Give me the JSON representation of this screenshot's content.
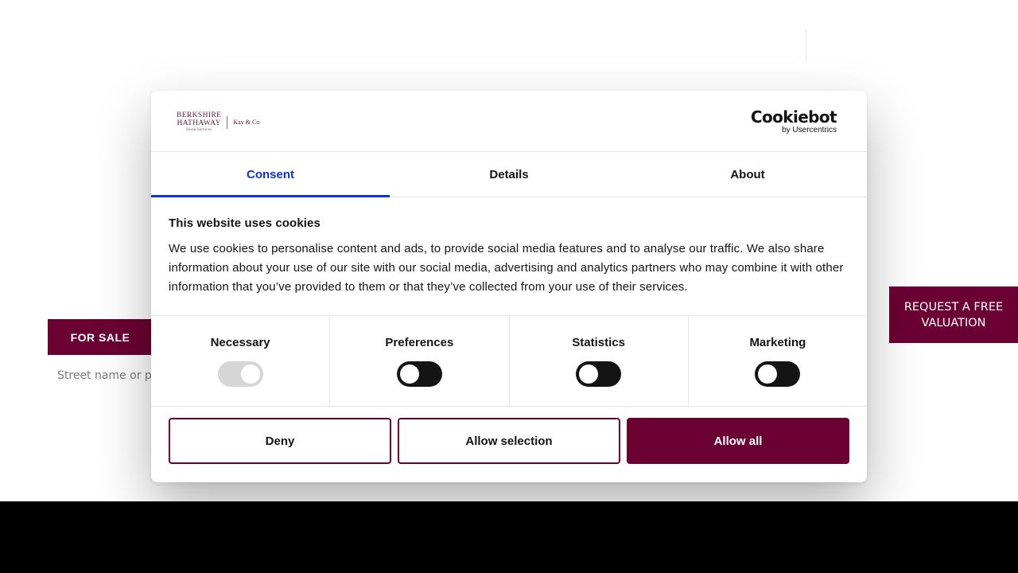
{
  "background": {
    "for_sale_tab": "FOR SALE",
    "search_placeholder": "Street name or po",
    "valuation_button": "REQUEST A FREE VALUATION"
  },
  "dialog": {
    "brand": {
      "line1": "BERKSHIRE",
      "line2": "HATHAWAY",
      "line3": "HomeServices",
      "sub": "Kay & Co"
    },
    "cookiebot": {
      "title": "Cookiebot",
      "subtitle": "by Usercentrics"
    },
    "tabs": [
      {
        "label": "Consent",
        "active": true
      },
      {
        "label": "Details",
        "active": false
      },
      {
        "label": "About",
        "active": false
      }
    ],
    "heading": "This website uses cookies",
    "body": "We use cookies to personalise content and ads, to provide social media features and to analyse our traffic. We also share information about your use of our site with our social media, advertising and analytics partners who may combine it with other information that you’ve provided to them or that they’ve collected from your use of their services.",
    "toggles": [
      {
        "label": "Necessary",
        "enabled": true,
        "locked": true
      },
      {
        "label": "Preferences",
        "enabled": false,
        "locked": false
      },
      {
        "label": "Statistics",
        "enabled": false,
        "locked": false
      },
      {
        "label": "Marketing",
        "enabled": false,
        "locked": false
      }
    ],
    "buttons": {
      "deny": "Deny",
      "allow_selection": "Allow selection",
      "allow_all": "Allow all"
    }
  },
  "colors": {
    "brand": "#6b0033",
    "active_tab": "#1032cf",
    "text": "#141414"
  }
}
